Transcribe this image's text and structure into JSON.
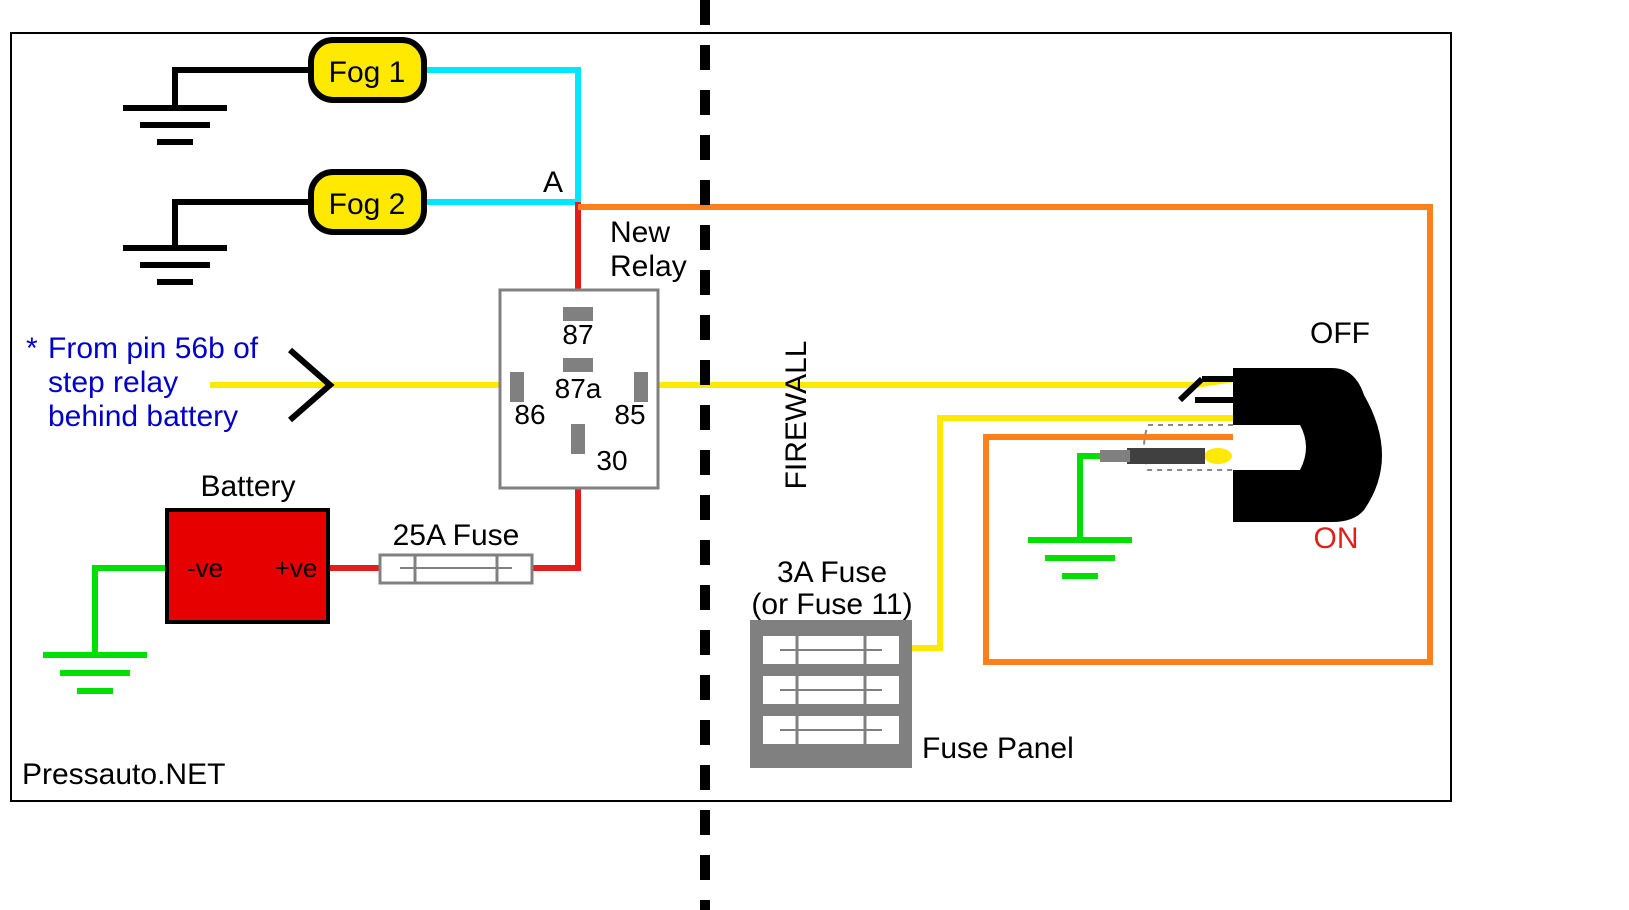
{
  "fogs": {
    "fog1_label": "Fog 1",
    "fog2_label": "Fog 2"
  },
  "junction": {
    "A_label": "A"
  },
  "relay": {
    "title_l1": "New",
    "title_l2": "Relay",
    "pin_87": "87",
    "pin_87a": "87a",
    "pin_86": "86",
    "pin_85": "85",
    "pin_30": "30"
  },
  "battery": {
    "title": "Battery",
    "neg_label": "-ve",
    "pos_label": "+ve"
  },
  "fuse25": {
    "label": "25A Fuse"
  },
  "fuse3": {
    "label_l1": "3A Fuse",
    "label_l2": "(or Fuse 11)",
    "panel_label": "Fuse Panel"
  },
  "firewall": {
    "label": "FIREWALL"
  },
  "switch": {
    "off_label": "OFF",
    "on_label": "ON"
  },
  "note": {
    "asterisk": "*",
    "l1": "From pin 56b of",
    "l2": "step relay",
    "l3": "behind battery"
  },
  "footer": {
    "credit": "Pressauto.NET"
  }
}
